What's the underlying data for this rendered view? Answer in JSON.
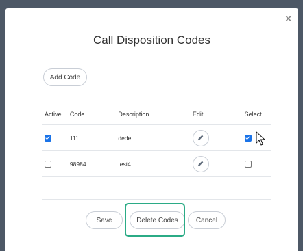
{
  "modal": {
    "title": "Call Disposition Codes",
    "close_glyph": "×"
  },
  "toolbar": {
    "add_label": "Add Code"
  },
  "table": {
    "headers": {
      "active": "Active",
      "code": "Code",
      "description": "Description",
      "edit": "Edit",
      "select": "Select"
    },
    "rows": [
      {
        "active": true,
        "code": "111",
        "description": "dede",
        "selected": true
      },
      {
        "active": false,
        "code": "98984",
        "description": "test4",
        "selected": false
      }
    ]
  },
  "footer": {
    "save_label": "Save",
    "delete_label": "Delete Codes",
    "cancel_label": "Cancel"
  },
  "icons": {
    "close": "close-icon",
    "edit": "pencil-icon",
    "cursor": "mouse-pointer-icon"
  },
  "colors": {
    "backdrop": "#4d5866",
    "checkbox_checked": "#1a73e8",
    "highlight": "#2bab86"
  }
}
